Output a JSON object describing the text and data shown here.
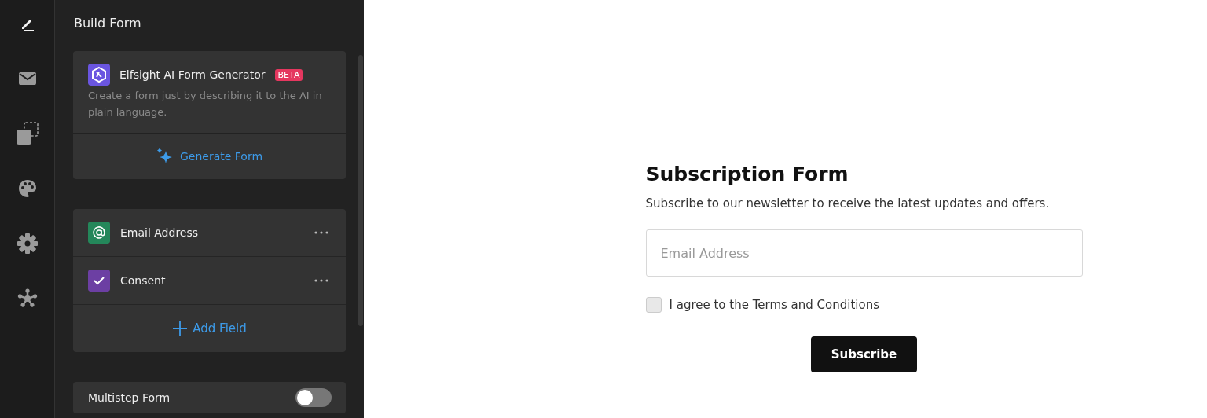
{
  "rail": [
    {
      "kind": "pen",
      "selected": true
    },
    {
      "kind": "mail",
      "selected": false
    },
    {
      "kind": "shapes",
      "selected": false
    },
    {
      "kind": "palette",
      "selected": false
    },
    {
      "kind": "gear",
      "selected": false
    },
    {
      "kind": "network",
      "selected": false
    }
  ],
  "panel": {
    "title": "Build Form",
    "ai_card": {
      "title": "Elfsight AI Form Generator",
      "badge": "BETA",
      "description": "Create a form just by describing it to the AI in plain language.",
      "action": "Generate Form"
    },
    "fields": [
      {
        "kind": "email",
        "label": "Email Address",
        "color": "#24875a"
      },
      {
        "kind": "checkbox",
        "label": "Consent",
        "color": "#6c3fa3"
      }
    ],
    "add_field": "Add Field",
    "multistep": {
      "label": "Multistep Form",
      "on": false
    }
  },
  "preview": {
    "title": "Subscription Form",
    "subtitle": "Subscribe to our newsletter to receive the latest updates and offers.",
    "email": {
      "placeholder": "Email Address"
    },
    "consent": {
      "label": "I agree to the Terms and Conditions",
      "checked": false
    },
    "submit": "Subscribe"
  }
}
